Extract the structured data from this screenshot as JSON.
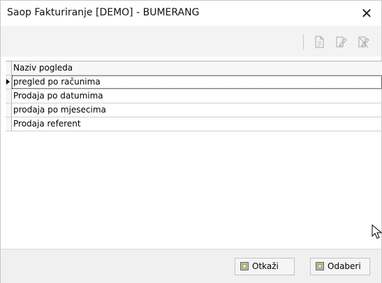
{
  "window": {
    "title": "Saop Fakturiranje [DEMO] - BUMERANG",
    "close_glyph": "✕"
  },
  "toolbar": {
    "icons": [
      "new-document-icon",
      "edit-document-icon",
      "delete-document-icon"
    ]
  },
  "grid": {
    "column_header": "Naziv pogleda",
    "selected_row_index": 0,
    "rows": [
      "pregled po računima",
      "Prodaja po datumima",
      "prodaja po mjesecima",
      "Prodaja referent"
    ]
  },
  "footer": {
    "cancel_label": "Otkaži",
    "select_label": "Odaberi"
  },
  "colors": {
    "button_icon_fill": "#e7b84a",
    "button_icon_border": "#2c6fc2"
  }
}
